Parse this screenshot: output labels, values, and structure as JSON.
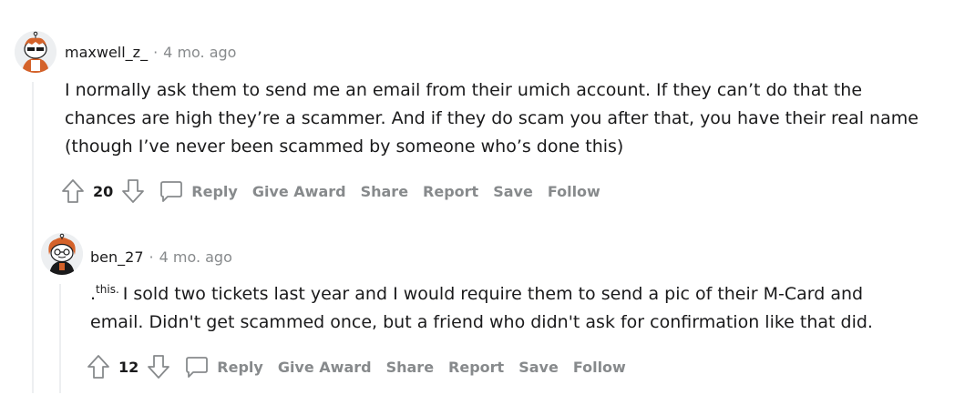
{
  "comments": [
    {
      "username": "maxwell_z_",
      "separator": "·",
      "age": "4 mo. ago",
      "body_lines": [
        "I normally ask them to send me an email from their umich account. If they can’t do that the",
        "chances are high they’re a scammer. And if they do scam you after that, you have their real name",
        "(though I’ve never been scammed by someone who’s done this)"
      ],
      "score": "20",
      "actions": {
        "reply": "Reply",
        "give_award": "Give Award",
        "share": "Share",
        "report": "Report",
        "save": "Save",
        "follow": "Follow"
      },
      "icons": {
        "avatar": "snoo-avatar-icon",
        "upvote": "upvote-arrow-icon",
        "downvote": "downvote-arrow-icon",
        "comment": "comment-bubble-icon"
      }
    },
    {
      "username": "ben_27",
      "separator": "·",
      "age": "4 mo. ago",
      "body_prefix": ".",
      "body_superscript": "this.",
      "body_lines": [
        "I sold two tickets last year and I would require them to send a pic of their M-Card and",
        "email. Didn't get scammed once, but a friend who didn't ask for confirmation like that did."
      ],
      "score": "12",
      "actions": {
        "reply": "Reply",
        "give_award": "Give Award",
        "share": "Share",
        "report": "Report",
        "save": "Save",
        "follow": "Follow"
      },
      "icons": {
        "avatar": "snoo-avatar-icon",
        "upvote": "upvote-arrow-icon",
        "downvote": "downvote-arrow-icon",
        "comment": "comment-bubble-icon"
      }
    }
  ],
  "colors": {
    "text": "#1a1a1b",
    "meta": "#878a8c",
    "thread_line": "#edeff1",
    "avatar_accent": "#d4622a"
  }
}
